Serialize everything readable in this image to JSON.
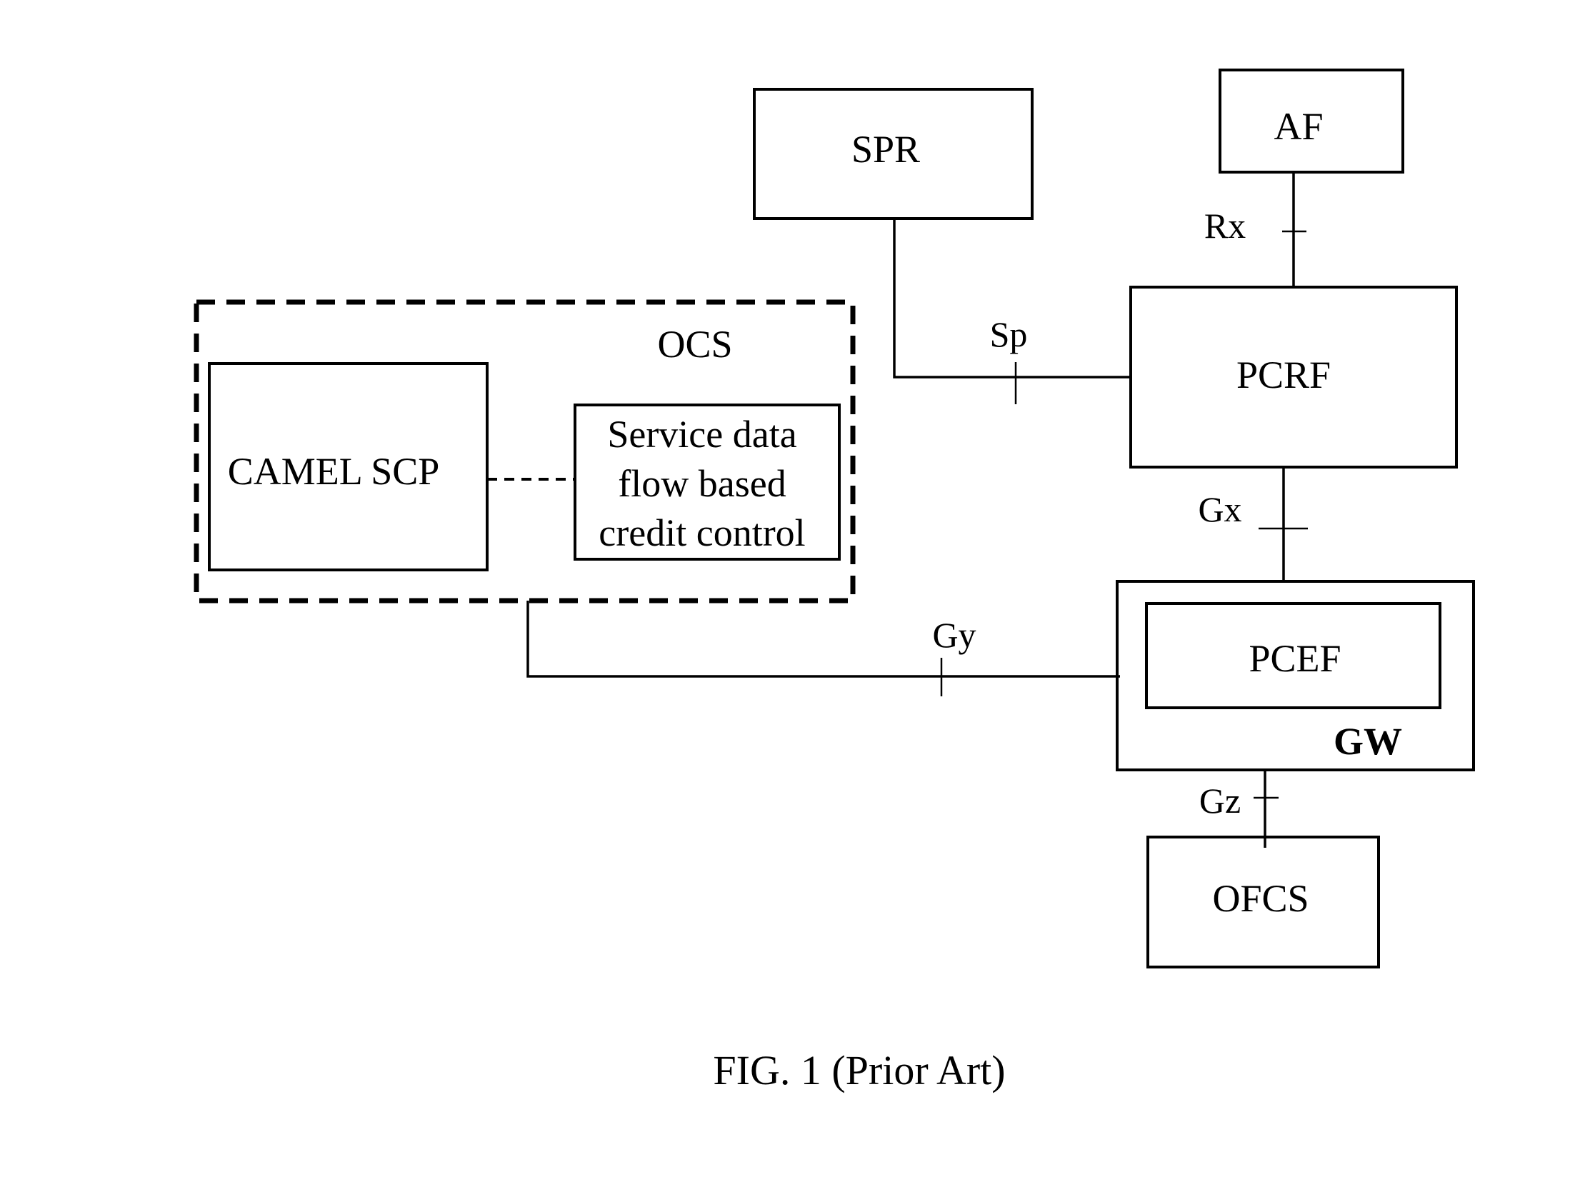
{
  "figure": {
    "caption": "FIG. 1 (Prior Art)"
  },
  "nodes": {
    "spr": "SPR",
    "af": "AF",
    "pcrf": "PCRF",
    "ocs": "OCS",
    "camel_scp": "CAMEL SCP",
    "sdf_credit_control": [
      "Service data",
      "flow based",
      "credit control"
    ],
    "pcef": "PCEF",
    "gw": "GW",
    "ofcs": "OFCS"
  },
  "interfaces": {
    "rx": "Rx",
    "sp": "Sp",
    "gx": "Gx",
    "gy": "Gy",
    "gz": "Gz"
  }
}
